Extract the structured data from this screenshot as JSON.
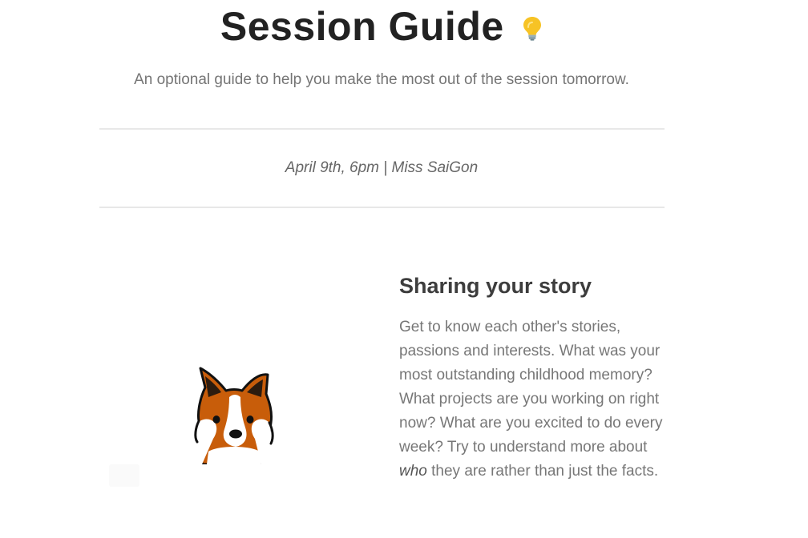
{
  "header": {
    "title": "Session Guide",
    "title_icon": "lightbulb-icon",
    "subtitle": "An optional guide to help you make the most out of the session tomorrow."
  },
  "event": {
    "info": "April 9th, 6pm | Miss SaiGon"
  },
  "section": {
    "illustration": "fox-icon",
    "heading": "Sharing your story",
    "body_before": "Get to know each other's stories, passions and interests. What was your most outstanding childhood memory? What projects are you working on right now? What are you excited to do every week? Try to understand more about ",
    "body_emphasis": "who",
    "body_after": " they are rather than just the facts."
  },
  "colors": {
    "title": "#222222",
    "subtitle": "#757575",
    "heading": "#3d3d3d",
    "body": "#777777",
    "divider": "#e8e8e8",
    "fox_orange": "#c85d0a"
  }
}
